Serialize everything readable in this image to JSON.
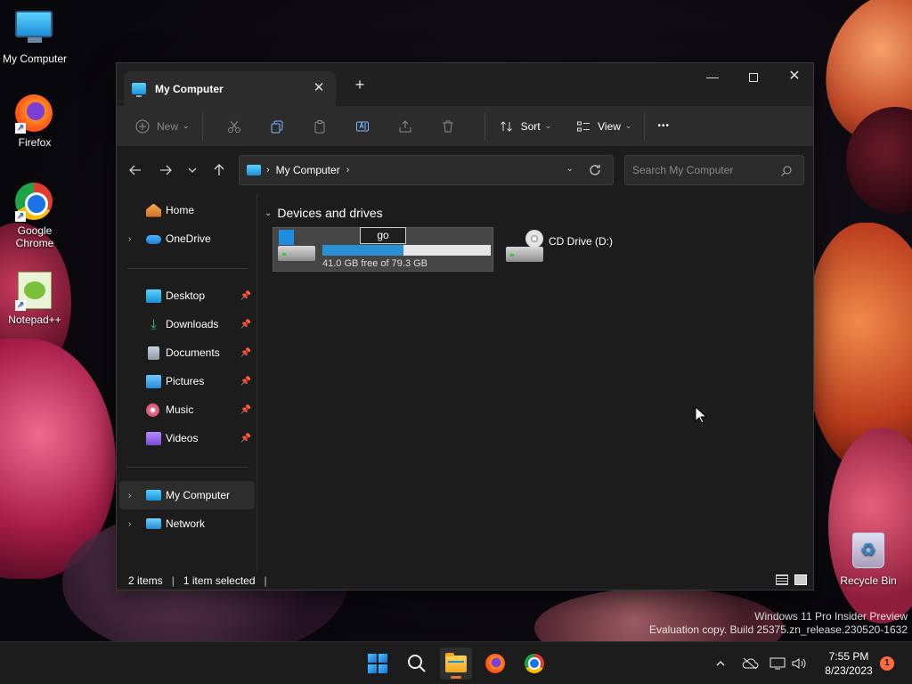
{
  "desktop": {
    "icons": [
      {
        "label": "My Computer"
      },
      {
        "label": "Firefox"
      },
      {
        "label": "Google Chrome"
      },
      {
        "label": "Notepad++"
      },
      {
        "label": "Recycle Bin"
      }
    ],
    "watermark_line1": "Windows 11 Pro Insider Preview",
    "watermark_line2": "Evaluation copy. Build 25375.zn_release.230520-1632"
  },
  "window": {
    "tab_title": "My Computer",
    "tab_close": "✕",
    "new_tab": "+",
    "minimize": "—",
    "close": "✕"
  },
  "toolbar": {
    "new_label": "New",
    "sort_label": "Sort",
    "view_label": "View",
    "more_label": "•••",
    "icons": [
      "plus-circle-icon",
      "cut-icon",
      "copy-icon",
      "paste-icon",
      "rename-icon",
      "share-icon",
      "delete-icon",
      "sort-icon",
      "view-icon"
    ]
  },
  "navigation": {
    "breadcrumb": [
      "My Computer"
    ],
    "breadcrumb_sep": "›",
    "search_placeholder": "Search My Computer"
  },
  "sidebar": {
    "items": [
      {
        "label": "Home",
        "icon": "home-icon",
        "expandable": false
      },
      {
        "label": "OneDrive",
        "icon": "cloud-icon",
        "expandable": true
      },
      {
        "label": "Desktop",
        "icon": "desktop-icon",
        "pinned": true
      },
      {
        "label": "Downloads",
        "icon": "download-icon",
        "pinned": true
      },
      {
        "label": "Documents",
        "icon": "documents-icon",
        "pinned": true
      },
      {
        "label": "Pictures",
        "icon": "pictures-icon",
        "pinned": true
      },
      {
        "label": "Music",
        "icon": "music-icon",
        "pinned": true
      },
      {
        "label": "Videos",
        "icon": "videos-icon",
        "pinned": true
      },
      {
        "label": "My Computer",
        "icon": "computer-icon",
        "expandable": true,
        "selected": true
      },
      {
        "label": "Network",
        "icon": "network-icon",
        "expandable": true
      }
    ]
  },
  "content": {
    "group_title": "Devices and drives",
    "drives": [
      {
        "rename_value": "go",
        "free_text": "41.0 GB free of 79.3 GB",
        "used_fraction": 0.48,
        "selected": true
      },
      {
        "label": "CD Drive (D:)"
      }
    ]
  },
  "status": {
    "items_count": "2 items",
    "selected_count": "1 item selected",
    "sep": "|"
  },
  "taskbar": {
    "time": "7:55 PM",
    "date": "8/23/2023",
    "notifications": "1"
  },
  "colors": {
    "accent": "#2b8fd4",
    "window_bg": "#1c1c1c",
    "toolbar_bg": "#2c2c2c",
    "notification": "#ff6a3d"
  }
}
